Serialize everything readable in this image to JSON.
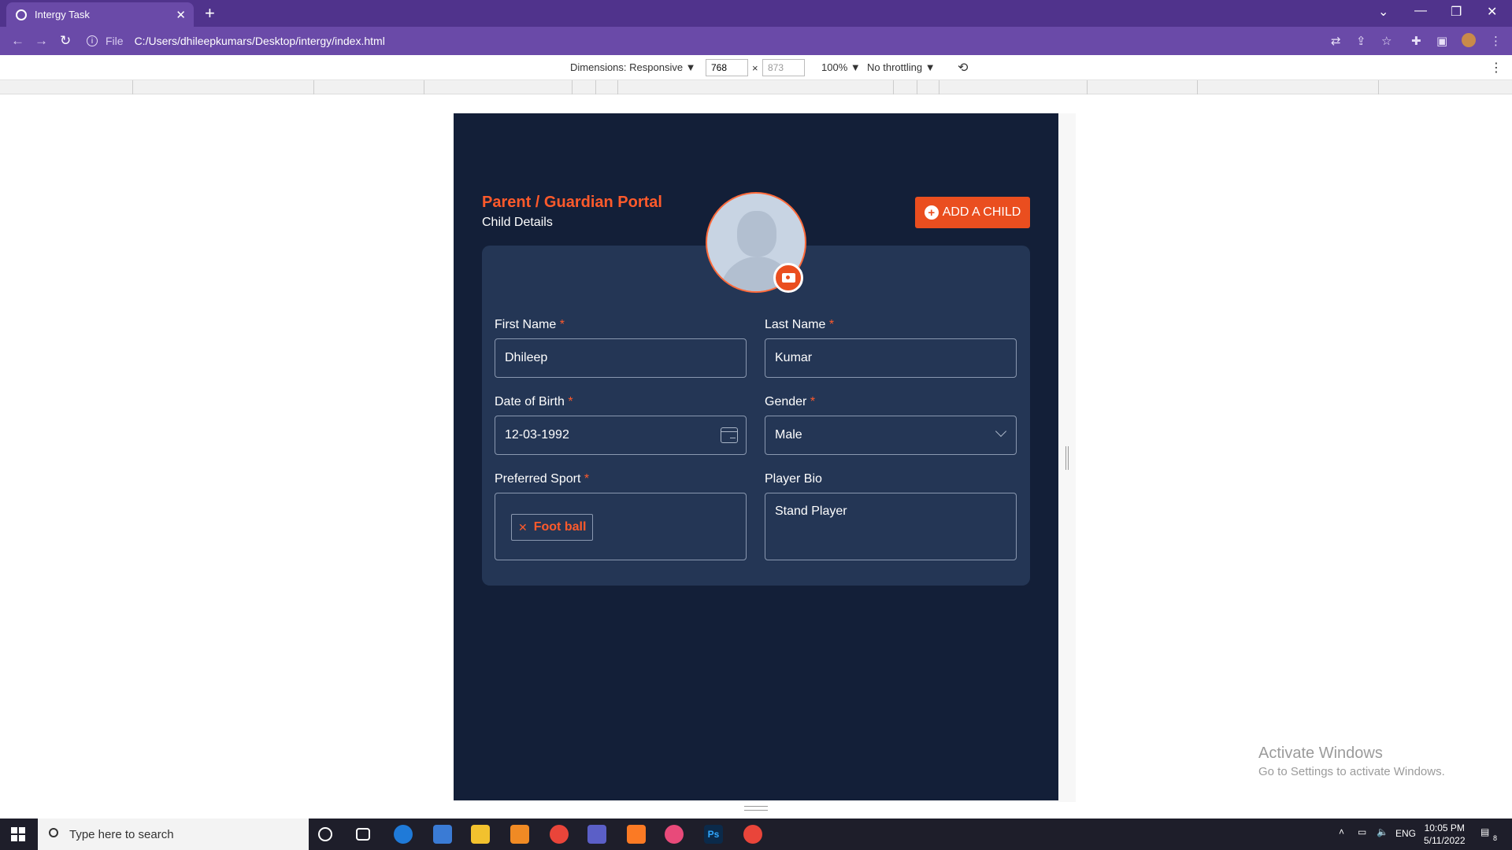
{
  "browser": {
    "tab_title": "Intergy Task",
    "address_prefix": "File",
    "url": "C:/Users/dhileepkumars/Desktop/intergy/index.html"
  },
  "devtools": {
    "dimensions_label": "Dimensions: Responsive ▼",
    "width_value": "768",
    "times": "×",
    "height_value": "873",
    "zoom": "100% ▼",
    "throttling": "No throttling ▼"
  },
  "page": {
    "portal_title": "Parent / Guardian Portal",
    "subtitle": "Child Details",
    "add_child_label": "ADD A CHILD",
    "required_marker": "*",
    "fields": {
      "first_name_label": "First Name",
      "first_name_value": "Dhileep",
      "last_name_label": "Last Name",
      "last_name_value": "Kumar",
      "dob_label": "Date of Birth",
      "dob_value": "12-03-1992",
      "gender_label": "Gender",
      "gender_value": "Male",
      "sport_label": "Preferred Sport",
      "sport_chip": "Foot ball",
      "bio_label": "Player Bio",
      "bio_value": "Stand Player"
    }
  },
  "watermark": {
    "title": "Activate Windows",
    "sub": "Go to Settings to activate Windows."
  },
  "taskbar": {
    "search_placeholder": "Type here to search",
    "lang": "ENG",
    "time": "10:05 PM",
    "date": "5/11/2022",
    "notif_count": "8"
  },
  "colors": {
    "accent": "#ea4e1f",
    "page_bg": "#131f38",
    "card_bg": "#243655",
    "browser_purple": "#50338c"
  }
}
